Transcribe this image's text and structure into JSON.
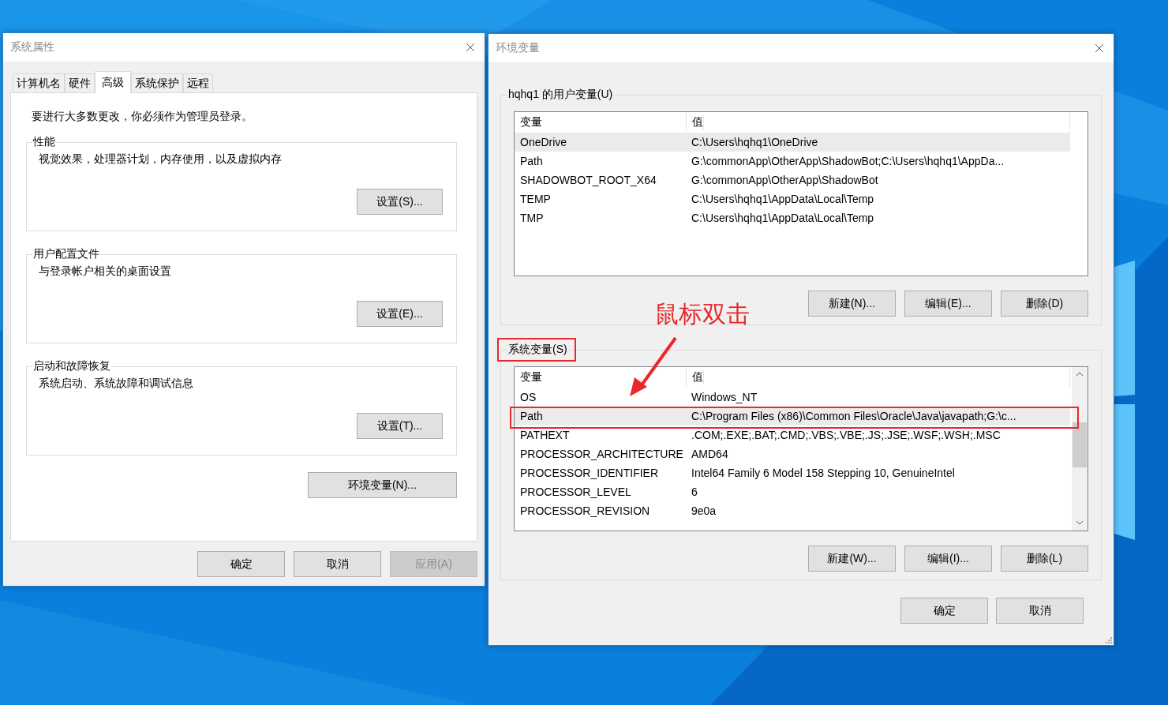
{
  "system_properties": {
    "title": "系统属性",
    "tabs": [
      {
        "label": "计算机名",
        "selected": false
      },
      {
        "label": "硬件",
        "selected": false
      },
      {
        "label": "高级",
        "selected": true
      },
      {
        "label": "系统保护",
        "selected": false
      },
      {
        "label": "远程",
        "selected": false
      }
    ],
    "notice": "要进行大多数更改，你必须作为管理员登录。",
    "groups": [
      {
        "title": "性能",
        "description": "视觉效果，处理器计划，内存使用，以及虚拟内存",
        "button": "设置(S)..."
      },
      {
        "title": "用户配置文件",
        "description": "与登录帐户相关的桌面设置",
        "button": "设置(E)..."
      },
      {
        "title": "启动和故障恢复",
        "description": "系统启动、系统故障和调试信息",
        "button": "设置(T)..."
      }
    ],
    "env_button": "环境变量(N)...",
    "buttons": [
      {
        "label": "确定",
        "disabled": false
      },
      {
        "label": "取消",
        "disabled": false
      },
      {
        "label": "应用(A)",
        "disabled": true
      }
    ]
  },
  "environment_variables": {
    "title": "环境变量",
    "user_vars": {
      "title": "hqhq1 的用户变量(U)",
      "columns": [
        "变量",
        "值"
      ],
      "rows": [
        {
          "name": "OneDrive",
          "value": "C:\\Users\\hqhq1\\OneDrive",
          "selected": true
        },
        {
          "name": "Path",
          "value": "G:\\commonApp\\OtherApp\\ShadowBot;C:\\Users\\hqhq1\\AppDa...",
          "selected": false
        },
        {
          "name": "SHADOWBOT_ROOT_X64",
          "value": "G:\\commonApp\\OtherApp\\ShadowBot",
          "selected": false
        },
        {
          "name": "TEMP",
          "value": "C:\\Users\\hqhq1\\AppData\\Local\\Temp",
          "selected": false
        },
        {
          "name": "TMP",
          "value": "C:\\Users\\hqhq1\\AppData\\Local\\Temp",
          "selected": false
        }
      ],
      "buttons": [
        "新建(N)...",
        "编辑(E)...",
        "删除(D)"
      ]
    },
    "system_vars": {
      "title": "系统变量(S)",
      "columns": [
        "变量",
        "值"
      ],
      "rows": [
        {
          "name": "OS",
          "value": "Windows_NT",
          "selected": false
        },
        {
          "name": "Path",
          "value": "C:\\Program Files (x86)\\Common Files\\Oracle\\Java\\javapath;G:\\c...",
          "selected": true
        },
        {
          "name": "PATHEXT",
          "value": ".COM;.EXE;.BAT;.CMD;.VBS;.VBE;.JS;.JSE;.WSF;.WSH;.MSC",
          "selected": false
        },
        {
          "name": "PROCESSOR_ARCHITECTURE",
          "value": "AMD64",
          "selected": false
        },
        {
          "name": "PROCESSOR_IDENTIFIER",
          "value": "Intel64 Family 6 Model 158 Stepping 10, GenuineIntel",
          "selected": false
        },
        {
          "name": "PROCESSOR_LEVEL",
          "value": "6",
          "selected": false
        },
        {
          "name": "PROCESSOR_REVISION",
          "value": "9e0a",
          "selected": false
        }
      ],
      "buttons": [
        "新建(W)...",
        "编辑(I)...",
        "删除(L)"
      ]
    },
    "buttons": [
      "确定",
      "取消"
    ]
  },
  "annotation": {
    "text": "鼠标双击"
  }
}
